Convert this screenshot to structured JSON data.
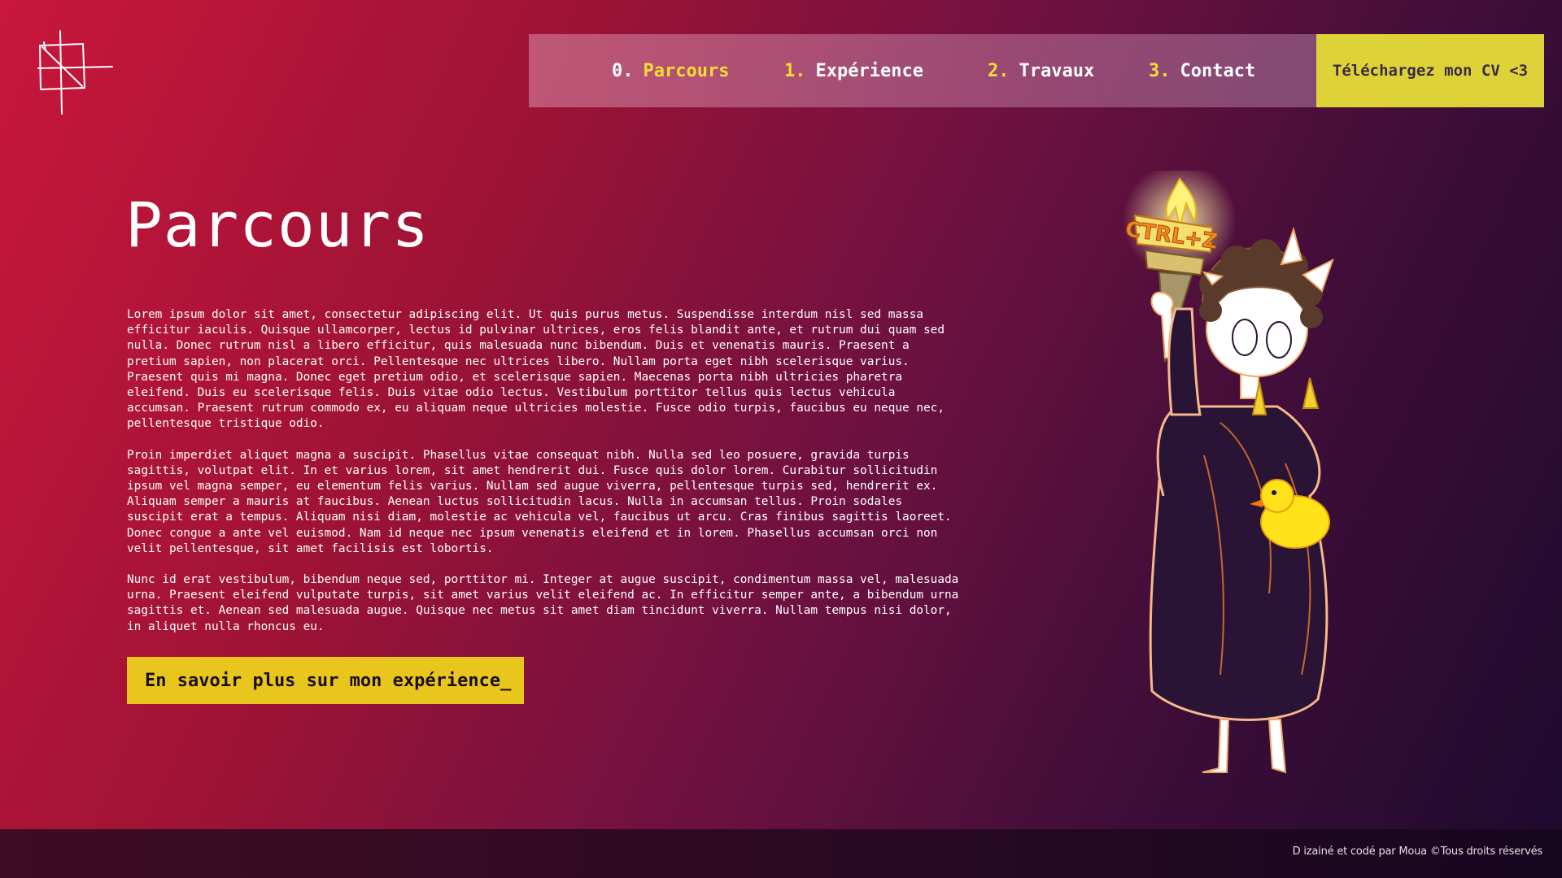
{
  "nav": {
    "items": [
      {
        "num": "0.",
        "label": "Parcours"
      },
      {
        "num": "1.",
        "label": "Expérience"
      },
      {
        "num": "2.",
        "label": "Travaux"
      },
      {
        "num": "3.",
        "label": "Contact"
      }
    ],
    "cv_button": "Téléchargez mon CV <3"
  },
  "main": {
    "title": "Parcours",
    "paragraphs": [
      "Lorem ipsum dolor sit amet, consectetur adipiscing elit. Ut quis purus metus. Suspendisse interdum nisl sed massa efficitur iaculis. Quisque ullamcorper, lectus id pulvinar ultrices, eros felis blandit ante, et rutrum dui quam sed nulla. Donec rutrum nisl a libero efficitur, quis malesuada nunc bibendum. Duis et venenatis mauris. Praesent a pretium sapien, non placerat orci. Pellentesque nec ultrices libero. Nullam porta eget nibh scelerisque varius. Praesent quis mi magna. Donec eget pretium odio, et scelerisque sapien. Maecenas porta nibh ultricies pharetra eleifend. Duis eu scelerisque felis. Duis vitae odio lectus. Vestibulum porttitor tellus quis lectus vehicula accumsan. Praesent rutrum commodo ex, eu aliquam neque ultricies molestie. Fusce odio turpis, faucibus eu neque nec, pellentesque tristique odio.",
      "Proin imperdiet aliquet magna a suscipit. Phasellus vitae consequat nibh. Nulla sed leo posuere, gravida turpis sagittis, volutpat elit. In et varius lorem, sit amet hendrerit dui. Fusce quis dolor lorem. Curabitur sollicitudin ipsum vel magna semper, eu elementum felis varius. Nullam sed augue viverra, pellentesque turpis sed, hendrerit ex. Aliquam semper a mauris at faucibus. Aenean luctus sollicitudin lacus. Nulla in accumsan tellus. Proin sodales suscipit erat a tempus. Aliquam nisi diam, molestie ac vehicula vel, faucibus ut arcu. Cras finibus sagittis laoreet. Donec congue a ante vel euismod. Nam id neque nec ipsum venenatis eleifend et in lorem. Phasellus accumsan orci non velit pellentesque, sit amet facilisis est lobortis.",
      "Nunc id erat vestibulum, bibendum neque sed, porttitor mi. Integer at augue suscipit, condimentum massa vel, malesuada urna. Praesent eleifend vulputate turpis, sit amet varius velit eleifend ac. In efficitur semper ante, a bibendum urna sagittis et. Aenean sed malesuada augue. Quisque nec metus sit amet diam tincidunt viverra. Nullam tempus nisi dolor, in aliquet nulla rhoncus eu."
    ],
    "cta": "En savoir plus sur mon expérience_"
  },
  "illustration": {
    "torch_text": "CTRL+Z"
  },
  "footer": {
    "text": "D izainé et codé par Moua ©Tous droits réservés"
  },
  "colors": {
    "accent_yellow": "#f2dd33",
    "cta_yellow": "#e8c61e",
    "cv_button": "#ddd338",
    "bg_start": "#c8173a",
    "bg_end": "#1e0a2e"
  },
  "icons": [
    "logo-icon",
    "torch-icon",
    "rubber-duck-icon"
  ]
}
